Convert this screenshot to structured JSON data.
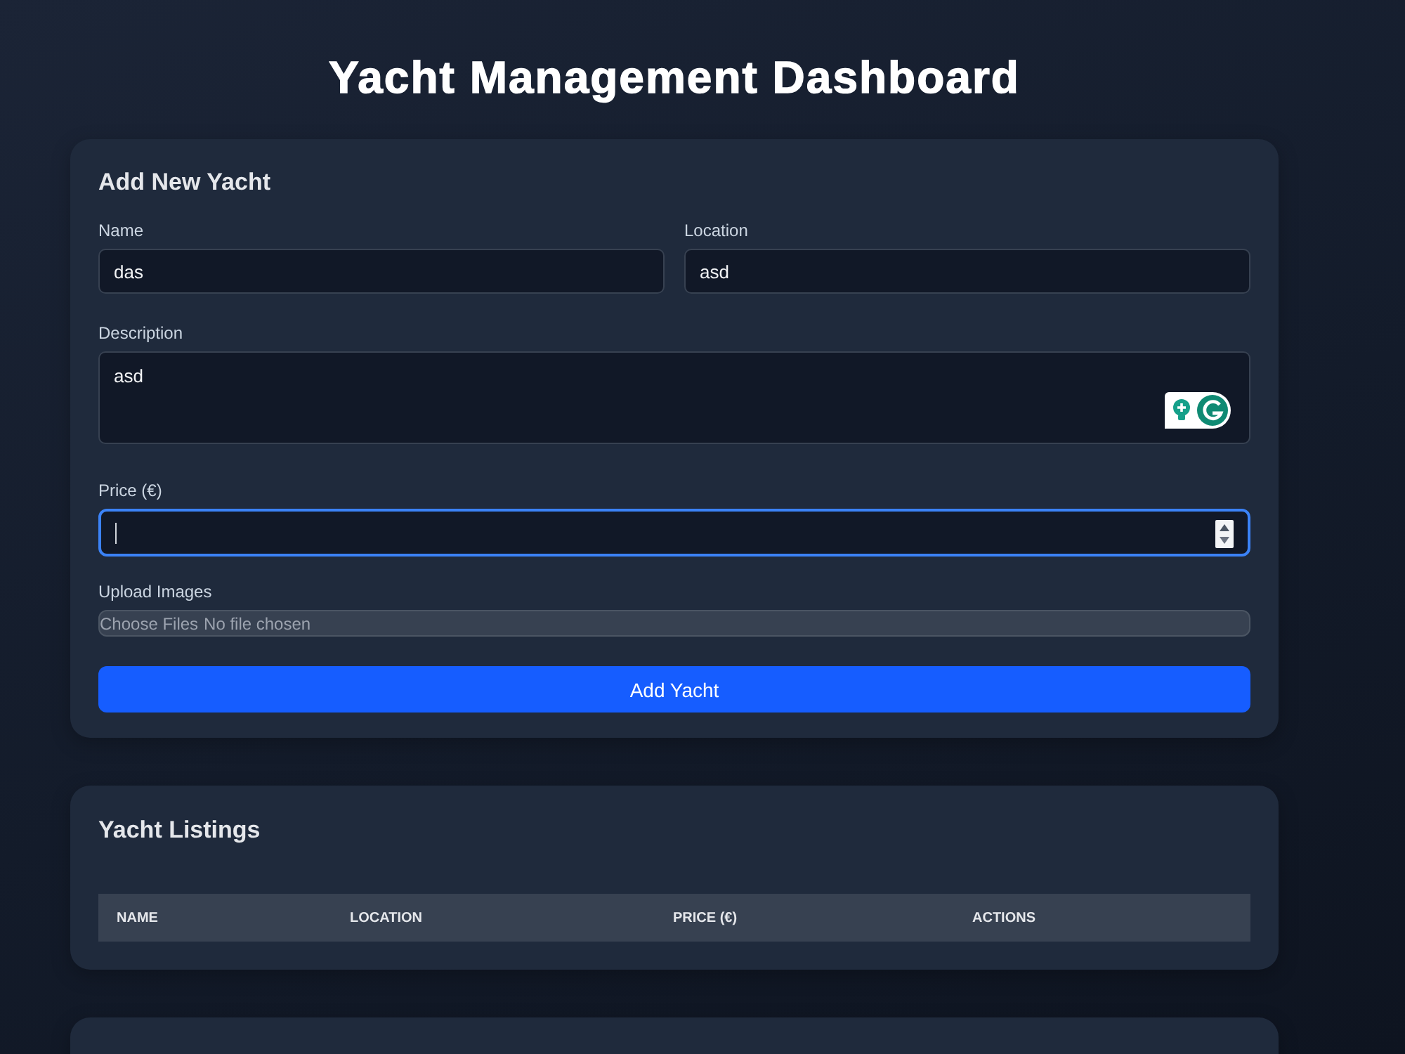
{
  "page": {
    "title": "Yacht Management Dashboard"
  },
  "add_form": {
    "title": "Add New Yacht",
    "fields": [
      {
        "kind": "text",
        "label": "Name",
        "value": "das",
        "focused": false
      },
      {
        "kind": "text",
        "label": "Location",
        "value": "asd",
        "focused": false
      },
      {
        "kind": "textarea",
        "label": "Description",
        "value": "asd",
        "focused": false
      },
      {
        "kind": "number",
        "label": "Price (€)",
        "focused": true
      },
      {
        "kind": "file",
        "label": "Upload Images",
        "button": "Choose Files",
        "status": "No file chosen",
        "focused": false
      }
    ],
    "submit": "Add Yacht"
  },
  "listings": {
    "title": "Yacht Listings",
    "table": {
      "columns": [
        "NAME",
        "LOCATION",
        "PRICE (€)",
        "ACTIONS"
      ]
    }
  }
}
